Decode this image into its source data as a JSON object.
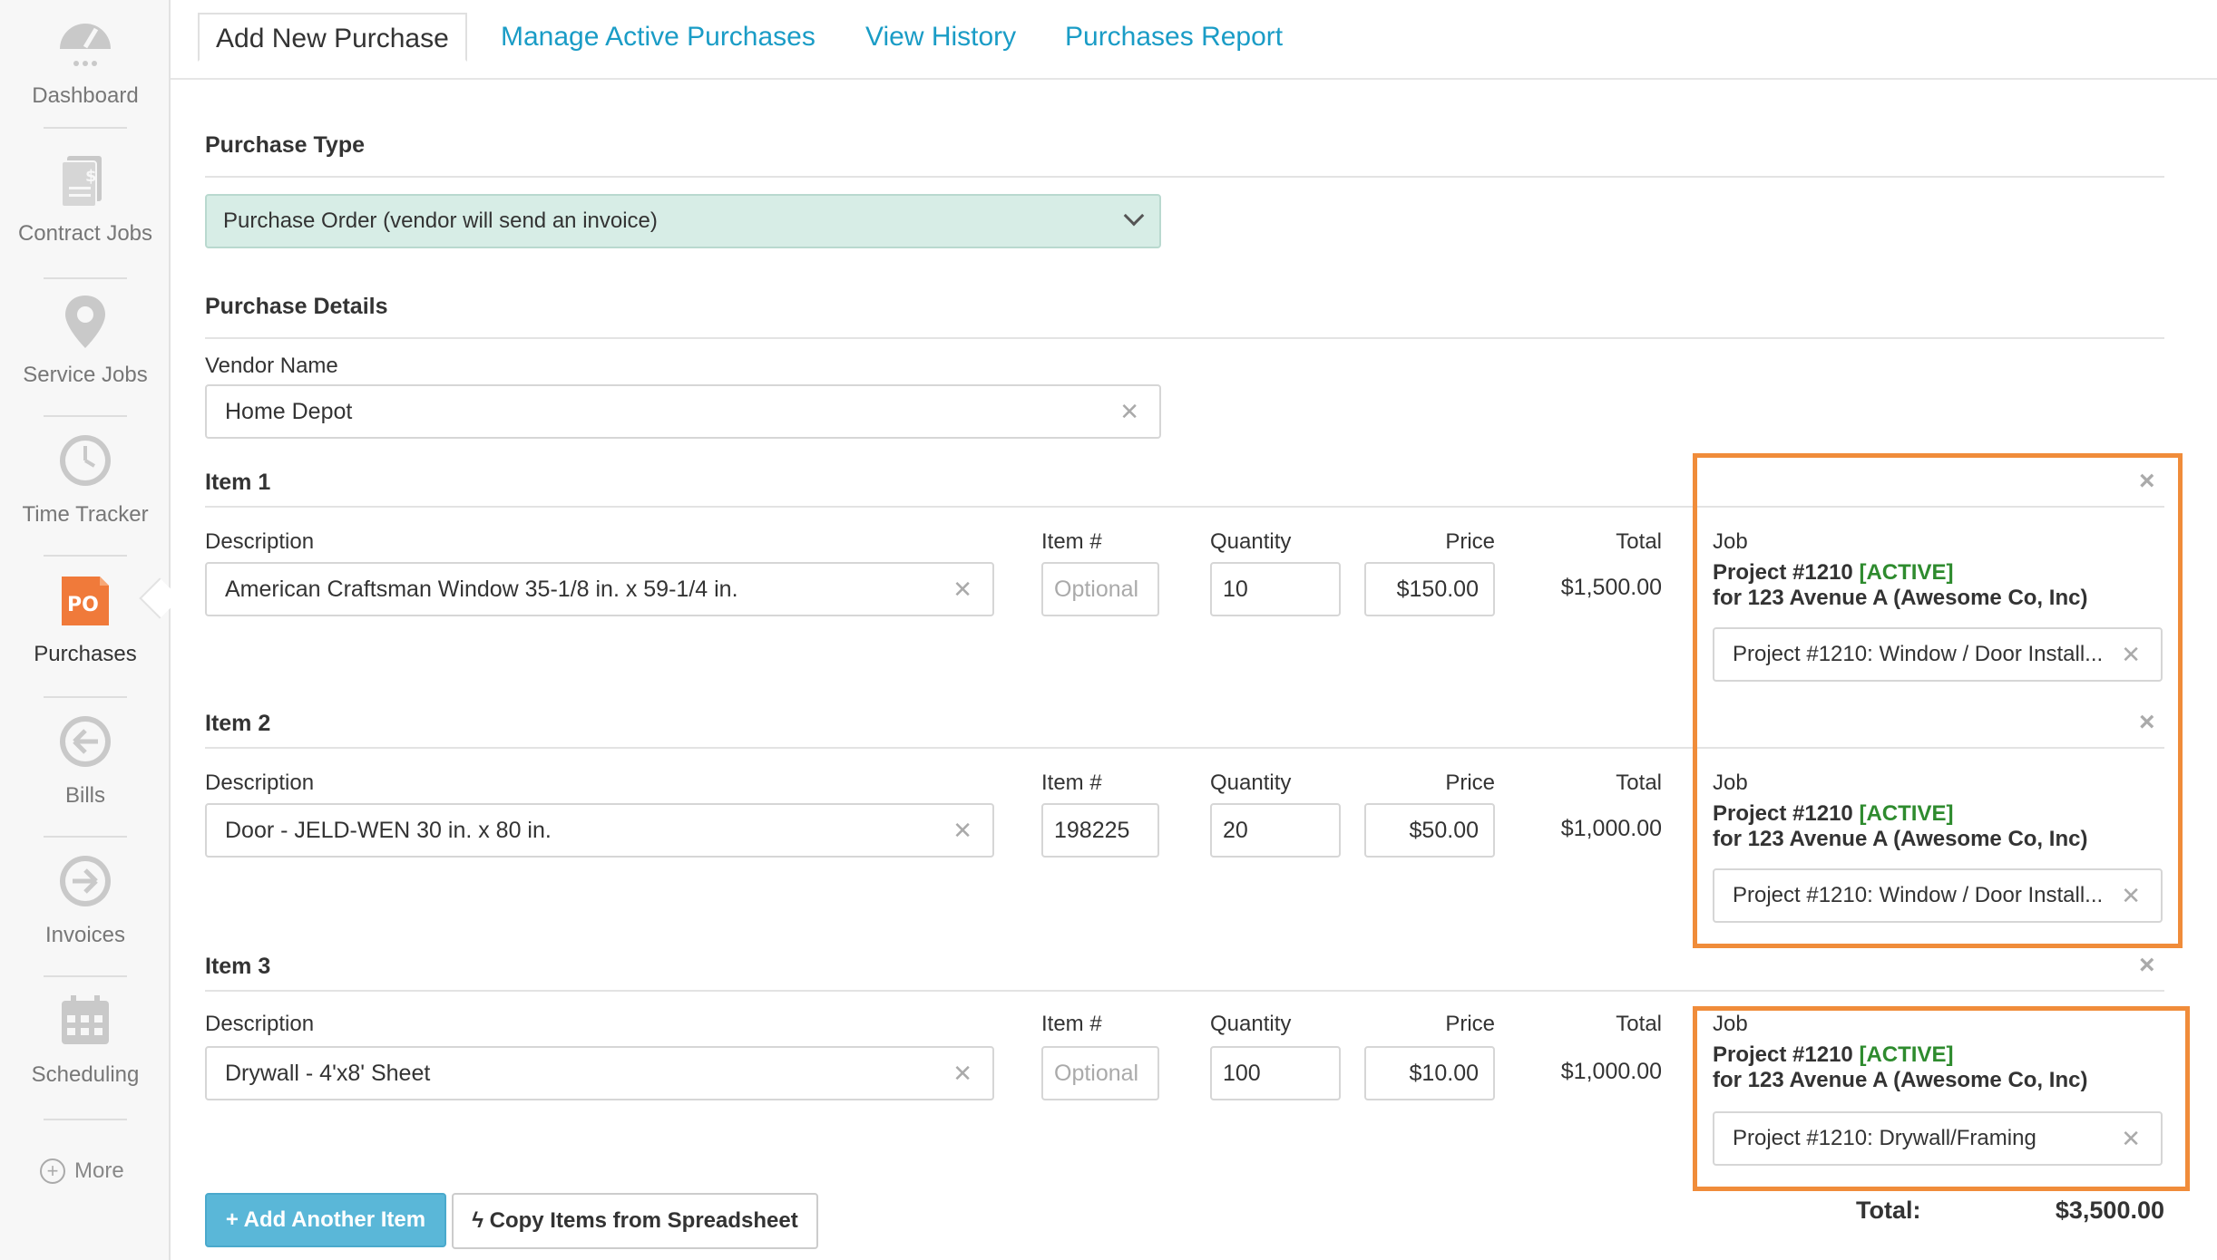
{
  "sidebar": {
    "items": [
      {
        "label": "Dashboard",
        "icon": "dashboard-gauge-icon"
      },
      {
        "label": "Contract Jobs",
        "icon": "document-dollar-icon"
      },
      {
        "label": "Service Jobs",
        "icon": "map-pin-icon"
      },
      {
        "label": "Time Tracker",
        "icon": "clock-icon"
      },
      {
        "label": "Purchases",
        "icon": "po-icon",
        "badge": "PO",
        "active": true
      },
      {
        "label": "Bills",
        "icon": "arrow-left-circle-icon"
      },
      {
        "label": "Invoices",
        "icon": "arrow-right-circle-icon"
      },
      {
        "label": "Scheduling",
        "icon": "calendar-icon"
      }
    ],
    "more": "More"
  },
  "tabs": [
    {
      "label": "Add New Purchase",
      "active": true
    },
    {
      "label": "Manage Active Purchases"
    },
    {
      "label": "View History"
    },
    {
      "label": "Purchases Report"
    }
  ],
  "purchase_type": {
    "title": "Purchase Type",
    "selected": "Purchase Order (vendor will send an invoice)"
  },
  "purchase_details": {
    "title": "Purchase Details",
    "vendor_label": "Vendor Name",
    "vendor_value": "Home Depot"
  },
  "columns": {
    "description": "Description",
    "item_no": "Item #",
    "quantity": "Quantity",
    "price": "Price",
    "total": "Total",
    "job": "Job"
  },
  "items": [
    {
      "title": "Item 1",
      "description": "American Craftsman Window 35-1/8 in. x 59-1/4 in.",
      "item_no": "",
      "item_no_placeholder": "Optional",
      "quantity": "10",
      "price": "$150.00",
      "total": "$1,500.00",
      "job_title": "Project #1210",
      "job_status": "[ACTIVE]",
      "job_for": "for 123 Avenue A (Awesome Co, Inc)",
      "job_select": "Project #1210: Window / Door Install..."
    },
    {
      "title": "Item 2",
      "description": "Door - JELD-WEN 30 in. x 80 in.",
      "item_no": "198225",
      "item_no_placeholder": "Optional",
      "quantity": "20",
      "price": "$50.00",
      "total": "$1,000.00",
      "job_title": "Project #1210",
      "job_status": "[ACTIVE]",
      "job_for": "for 123 Avenue A (Awesome Co, Inc)",
      "job_select": "Project #1210: Window / Door Install..."
    },
    {
      "title": "Item 3",
      "description": "Drywall - 4'x8' Sheet",
      "item_no": "",
      "item_no_placeholder": "Optional",
      "quantity": "100",
      "price": "$10.00",
      "total": "$1,000.00",
      "job_title": "Project #1210",
      "job_status": "[ACTIVE]",
      "job_for": "for 123 Avenue A (Awesome Co, Inc)",
      "job_select": "Project #1210: Drywall/Framing"
    }
  ],
  "actions": {
    "add_item": "+ Add Another Item",
    "copy_items": "Copy Items from Spreadsheet"
  },
  "grand_total": {
    "label": "Total:",
    "value": "$3,500.00"
  },
  "colors": {
    "link": "#1a9cc6",
    "active_status": "#2e8b2e",
    "highlight": "#f08c3a",
    "po_badge": "#f07a3a",
    "select_bg": "#d7ede6"
  }
}
